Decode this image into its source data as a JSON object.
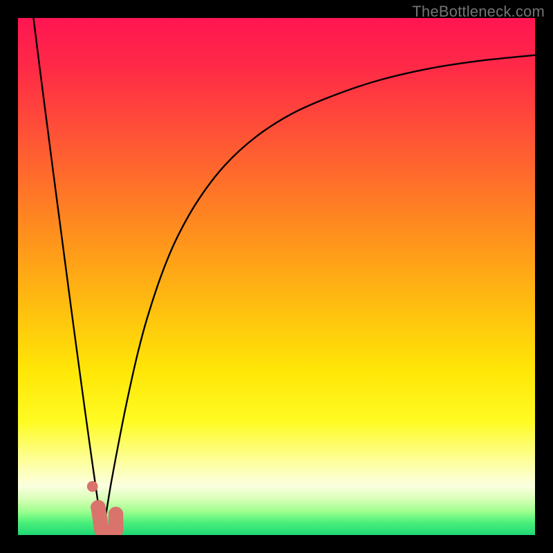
{
  "watermark": "TheBottleneck.com",
  "chart_data": {
    "type": "line",
    "title": "",
    "xlabel": "",
    "ylabel": "",
    "xlim": [
      0,
      100
    ],
    "ylim": [
      0,
      100
    ],
    "grid": false,
    "legend": false,
    "gradient_stops": [
      {
        "offset": 0.0,
        "color": "#ff1552"
      },
      {
        "offset": 0.1,
        "color": "#ff2b46"
      },
      {
        "offset": 0.25,
        "color": "#ff5a33"
      },
      {
        "offset": 0.4,
        "color": "#ff8a1f"
      },
      {
        "offset": 0.55,
        "color": "#ffbb10"
      },
      {
        "offset": 0.68,
        "color": "#ffe607"
      },
      {
        "offset": 0.78,
        "color": "#fffb22"
      },
      {
        "offset": 0.86,
        "color": "#fdffa0"
      },
      {
        "offset": 0.905,
        "color": "#fbffe0"
      },
      {
        "offset": 0.93,
        "color": "#d9ffb8"
      },
      {
        "offset": 0.955,
        "color": "#9cff8e"
      },
      {
        "offset": 0.975,
        "color": "#4cf07a"
      },
      {
        "offset": 1.0,
        "color": "#1fd876"
      }
    ],
    "series": [
      {
        "name": "left-curve",
        "stroke": "#000000",
        "stroke_width": 2.4,
        "x": [
          3.0,
          4.0,
          5.0,
          6.0,
          7.0,
          8.0,
          9.0,
          10.0,
          11.0,
          12.0,
          13.0,
          14.0,
          15.0,
          15.8,
          16.3
        ],
        "y": [
          100.0,
          92.0,
          84.2,
          76.5,
          68.8,
          61.2,
          53.6,
          46.0,
          38.5,
          31.1,
          23.8,
          16.6,
          9.6,
          4.0,
          1.0
        ]
      },
      {
        "name": "right-curve",
        "stroke": "#000000",
        "stroke_width": 2.4,
        "x": [
          16.3,
          17.0,
          18.0,
          19.5,
          21.0,
          23.0,
          25.0,
          28.0,
          31.0,
          35.0,
          40.0,
          46.0,
          53.0,
          61.0,
          70.0,
          80.0,
          90.0,
          100.0
        ],
        "y": [
          1.0,
          4.0,
          10.0,
          18.0,
          25.5,
          34.5,
          42.0,
          51.0,
          58.0,
          65.0,
          71.5,
          77.0,
          81.5,
          85.0,
          88.0,
          90.3,
          91.8,
          92.8
        ]
      }
    ],
    "markers": [
      {
        "name": "marker-dot-upper",
        "shape": "circle",
        "x": 14.4,
        "y": 9.4,
        "r": 1.05,
        "fill": "#d9736b"
      },
      {
        "name": "marker-dot-mid",
        "shape": "circle",
        "x": 15.2,
        "y": 5.4,
        "r": 1.15,
        "fill": "#d9736b"
      },
      {
        "name": "marker-blob",
        "shape": "blob",
        "x": 17.0,
        "y": 2.5,
        "w": 4.6,
        "h": 5.2,
        "fill": "#d9736b"
      }
    ]
  }
}
